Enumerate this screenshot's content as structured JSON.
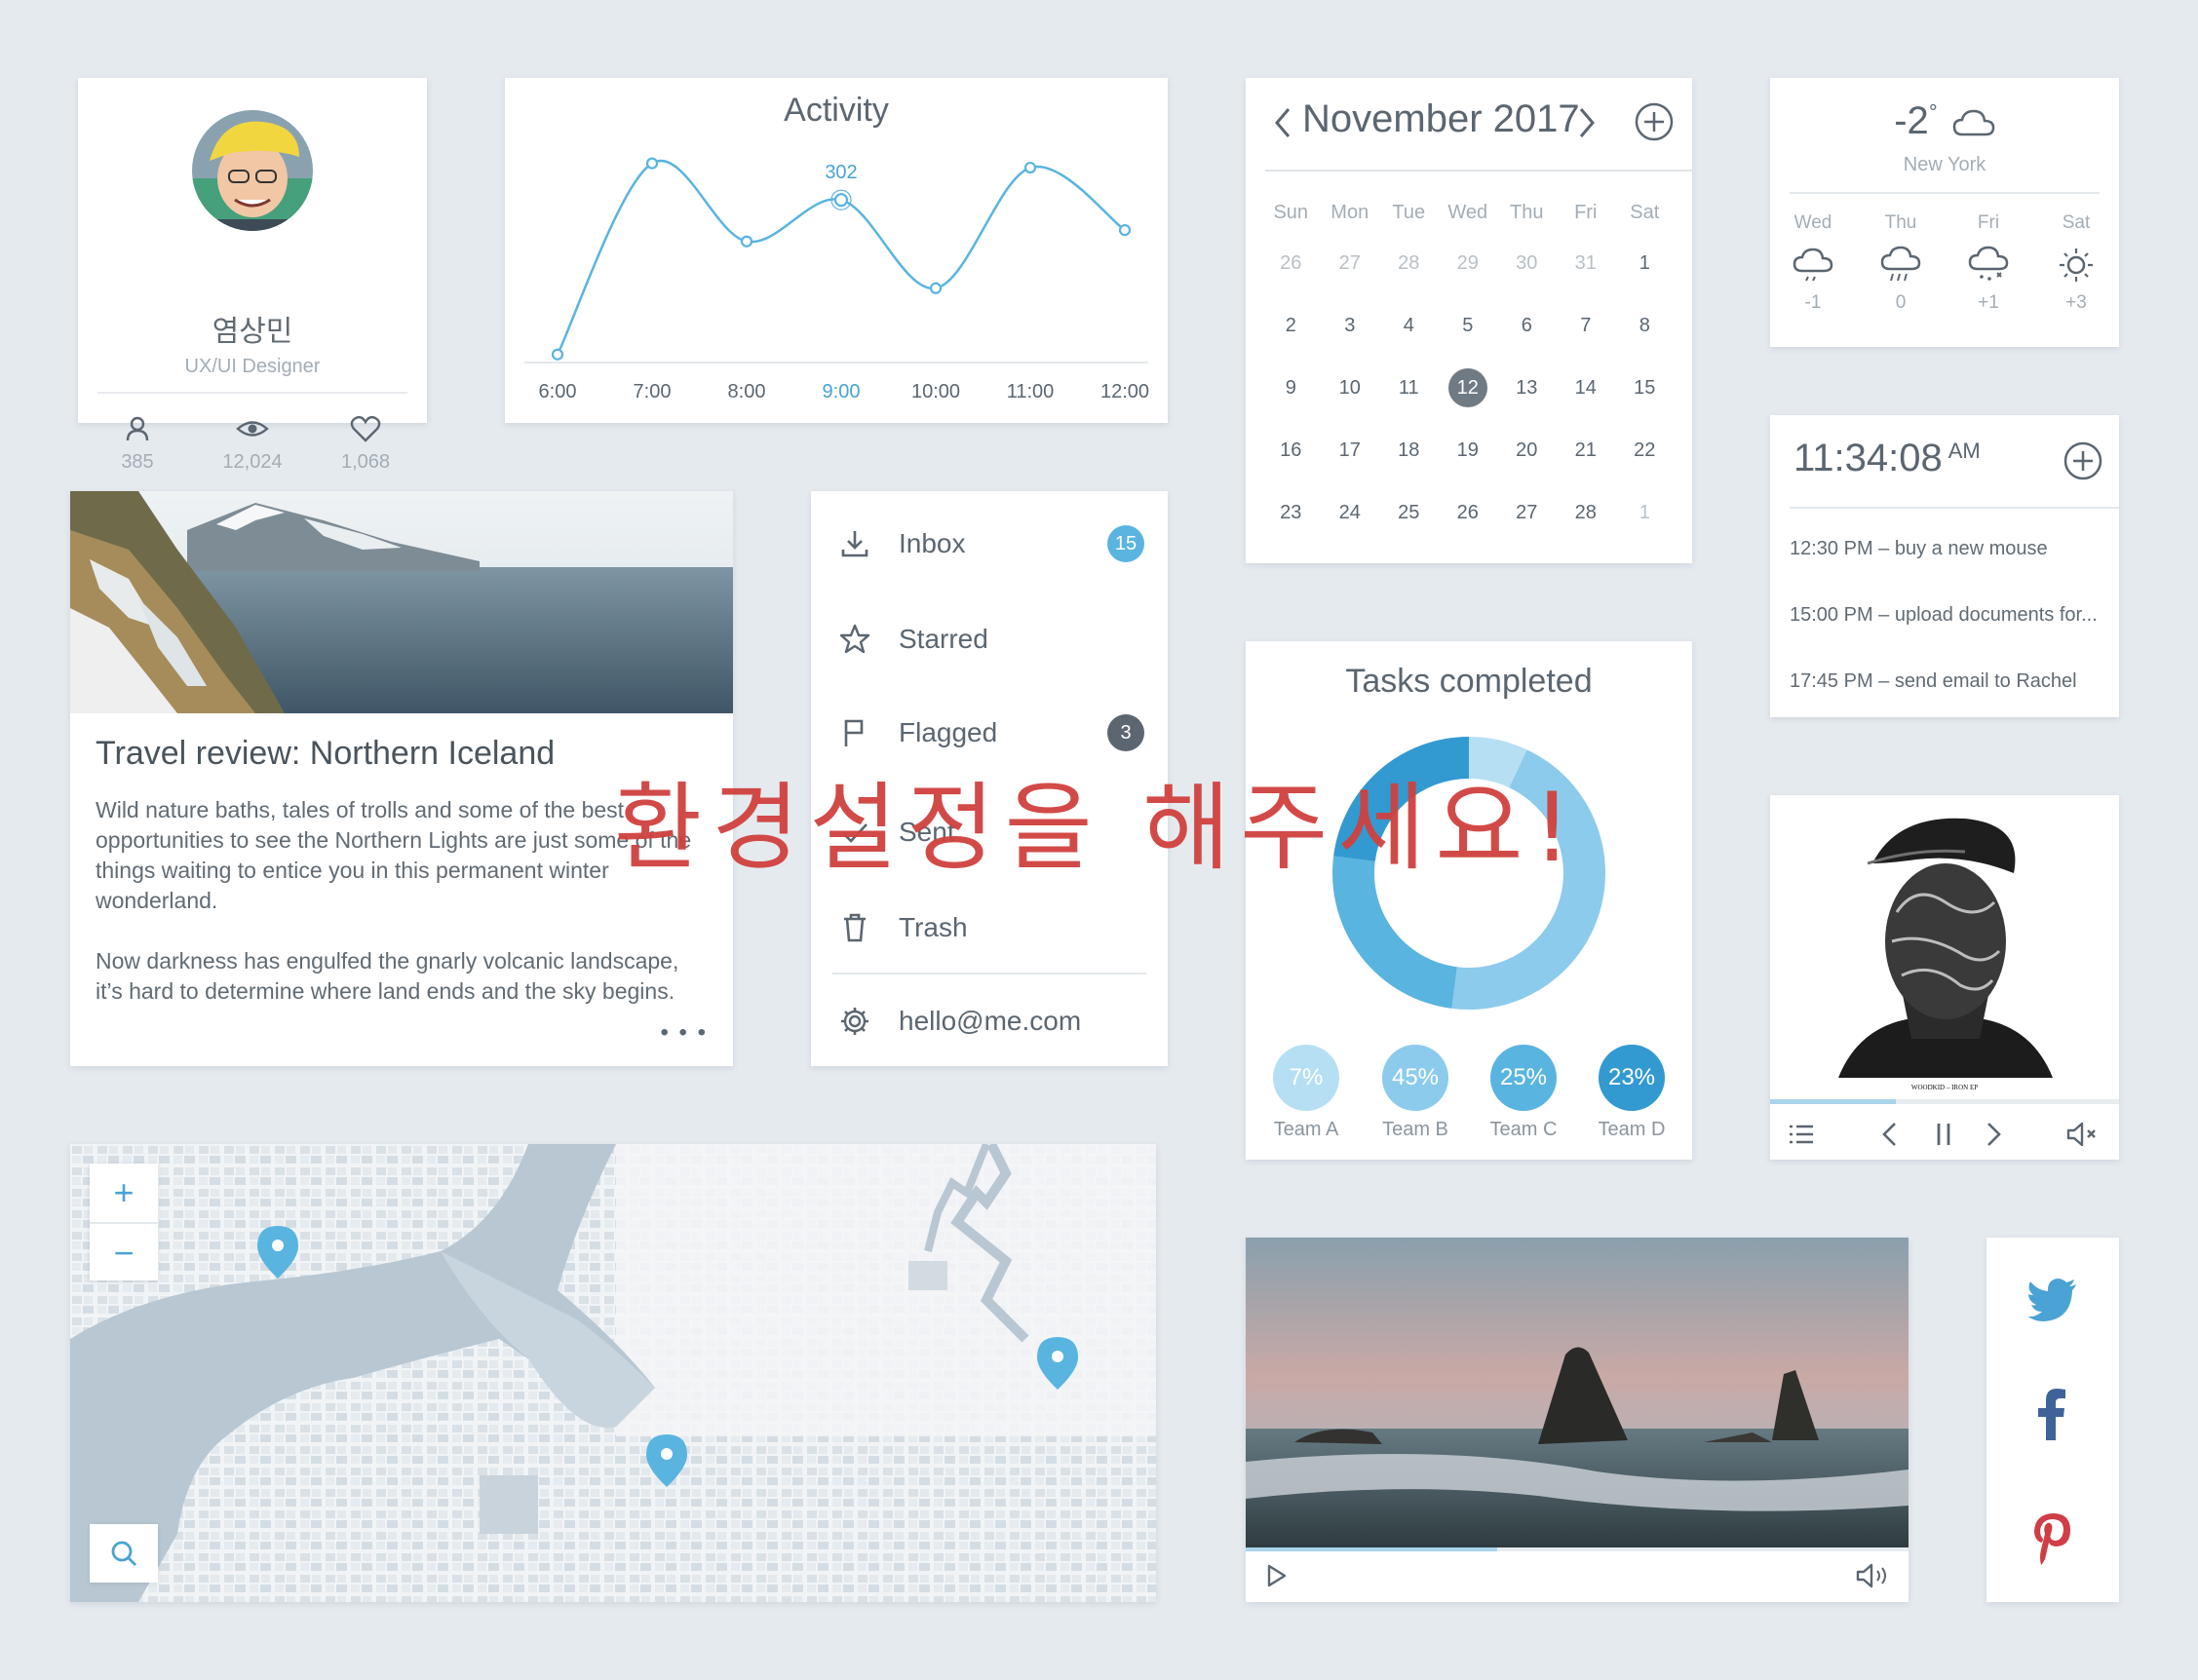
{
  "profile": {
    "name": "염상민",
    "role": "UX/UI Designer",
    "stats": [
      {
        "icon": "user-icon",
        "value": "385"
      },
      {
        "icon": "eye-icon",
        "value": "12,024"
      },
      {
        "icon": "heart-icon",
        "value": "1,068"
      }
    ]
  },
  "activity": {
    "title": "Activity",
    "highlight_label": "302",
    "chart_data": {
      "type": "line",
      "title": "Activity",
      "categories": [
        "6:00",
        "7:00",
        "8:00",
        "9:00",
        "10:00",
        "11:00",
        "12:00"
      ],
      "x_hours": [
        6.0,
        7.0,
        8.0,
        9.0,
        10.0,
        11.0,
        12.0
      ],
      "points": [
        {
          "x": 6.0,
          "y": 15
        },
        {
          "x": 7.0,
          "y": 370
        },
        {
          "x": 8.0,
          "y": 225
        },
        {
          "x": 9.0,
          "y": 302
        },
        {
          "x": 10.0,
          "y": 138
        },
        {
          "x": 11.0,
          "y": 362
        },
        {
          "x": 12.0,
          "y": 246
        }
      ],
      "highlight_index": 3,
      "highlight_value": 302,
      "ylim": [
        0,
        420
      ],
      "grid": false,
      "color": "#4aa3d4"
    }
  },
  "calendar": {
    "month_label": "November 2017",
    "weekdays": [
      "Sun",
      "Mon",
      "Tue",
      "Wed",
      "Thu",
      "Fri",
      "Sat"
    ],
    "weeks": [
      [
        "26",
        "27",
        "28",
        "29",
        "30",
        "31",
        "1"
      ],
      [
        "2",
        "3",
        "4",
        "5",
        "6",
        "7",
        "8"
      ],
      [
        "9",
        "10",
        "11",
        "12",
        "13",
        "14",
        "15"
      ],
      [
        "16",
        "17",
        "18",
        "19",
        "20",
        "21",
        "22"
      ],
      [
        "23",
        "24",
        "25",
        "26",
        "27",
        "28",
        "1"
      ]
    ],
    "today": "12"
  },
  "weather": {
    "temp": "-2",
    "degree": "°",
    "city": "New York",
    "forecast": [
      {
        "day": "Wed",
        "icon": "cloud-icon",
        "temp": "-1"
      },
      {
        "day": "Thu",
        "icon": "rain-icon",
        "temp": "0"
      },
      {
        "day": "Fri",
        "icon": "snow-sun-icon",
        "temp": "+1"
      },
      {
        "day": "Sat",
        "icon": "sun-icon",
        "temp": "+3"
      }
    ]
  },
  "clock": {
    "time": "11:34:08",
    "ampm": "AM",
    "reminders": [
      "12:30 PM – buy a new mouse",
      "15:00  PM – upload documents for...",
      "17:45  PM – send email to Rachel"
    ]
  },
  "article": {
    "title": "Travel review: Northern Iceland",
    "paragraph1": "Wild nature baths, tales of trolls and some of the best opportunities to see the Northern Lights are just some of the things waiting to entice you in this permanent winter wonderland.",
    "paragraph2": "Now darkness has engulfed the gnarly volcanic landscape, it’s hard to determine where land ends and the sky begins.",
    "more": "• • •"
  },
  "mail": {
    "items": [
      {
        "label": "Inbox",
        "icon": "download-icon",
        "badge": "15",
        "badge_color": "#5ab4e0"
      },
      {
        "label": "Starred",
        "icon": "star-icon",
        "badge": "",
        "badge_color": ""
      },
      {
        "label": "Flagged",
        "icon": "flag-icon",
        "badge": "3",
        "badge_color": "#5b6670"
      },
      {
        "label": "Sent",
        "icon": "check-icon",
        "badge": "",
        "badge_color": ""
      },
      {
        "label": "Trash",
        "icon": "trash-icon",
        "badge": "",
        "badge_color": ""
      }
    ],
    "account": "hello@me.com"
  },
  "tasks": {
    "title": "Tasks completed",
    "chart_data": {
      "type": "pie",
      "title": "Tasks completed",
      "categories": [
        "Team A",
        "Team B",
        "Team C",
        "Team D"
      ],
      "values": [
        7,
        45,
        25,
        23
      ],
      "labels": [
        "7%",
        "45%",
        "25%",
        "23%"
      ],
      "colors": [
        "#b6dff3",
        "#8ccbec",
        "#5ab4e0",
        "#3399d1"
      ]
    }
  },
  "music": {
    "album_caption": "WOODKID – IRON EP",
    "progress": 0.36
  },
  "map": {
    "zoom_in": "+",
    "zoom_out": "−",
    "pins": 3
  },
  "video": {
    "progress": 0.38
  },
  "overlay": {
    "text": "환경설정을 해주세요!"
  }
}
